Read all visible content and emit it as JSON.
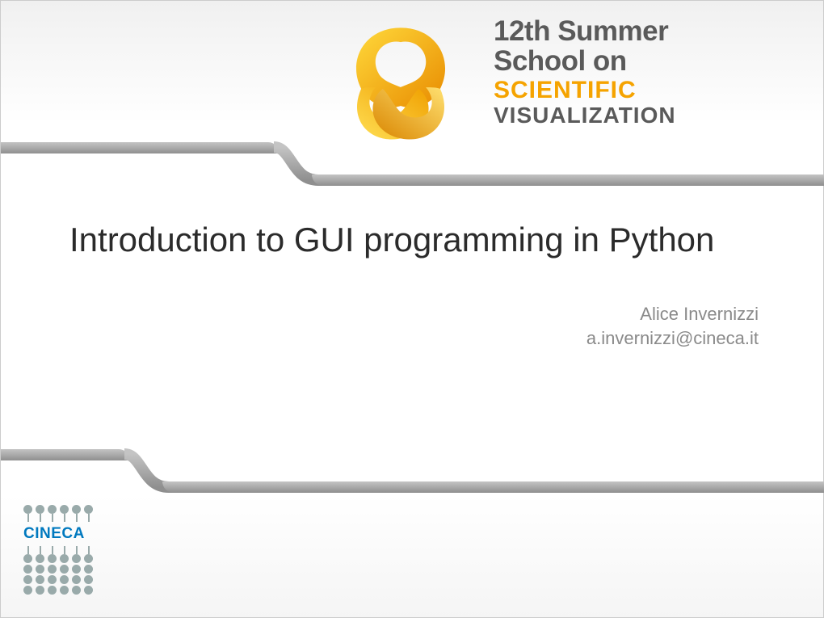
{
  "header": {
    "event_line1": "12th Summer",
    "event_line2": "School on",
    "event_line3": "SCIENTIFIC",
    "event_line4": "VISUALIZATION"
  },
  "content": {
    "title": "Introduction to GUI programming in Python",
    "author": "Alice Invernizzi",
    "email": "a.invernizzi@cineca.it"
  },
  "footer": {
    "org": "CINECA"
  }
}
